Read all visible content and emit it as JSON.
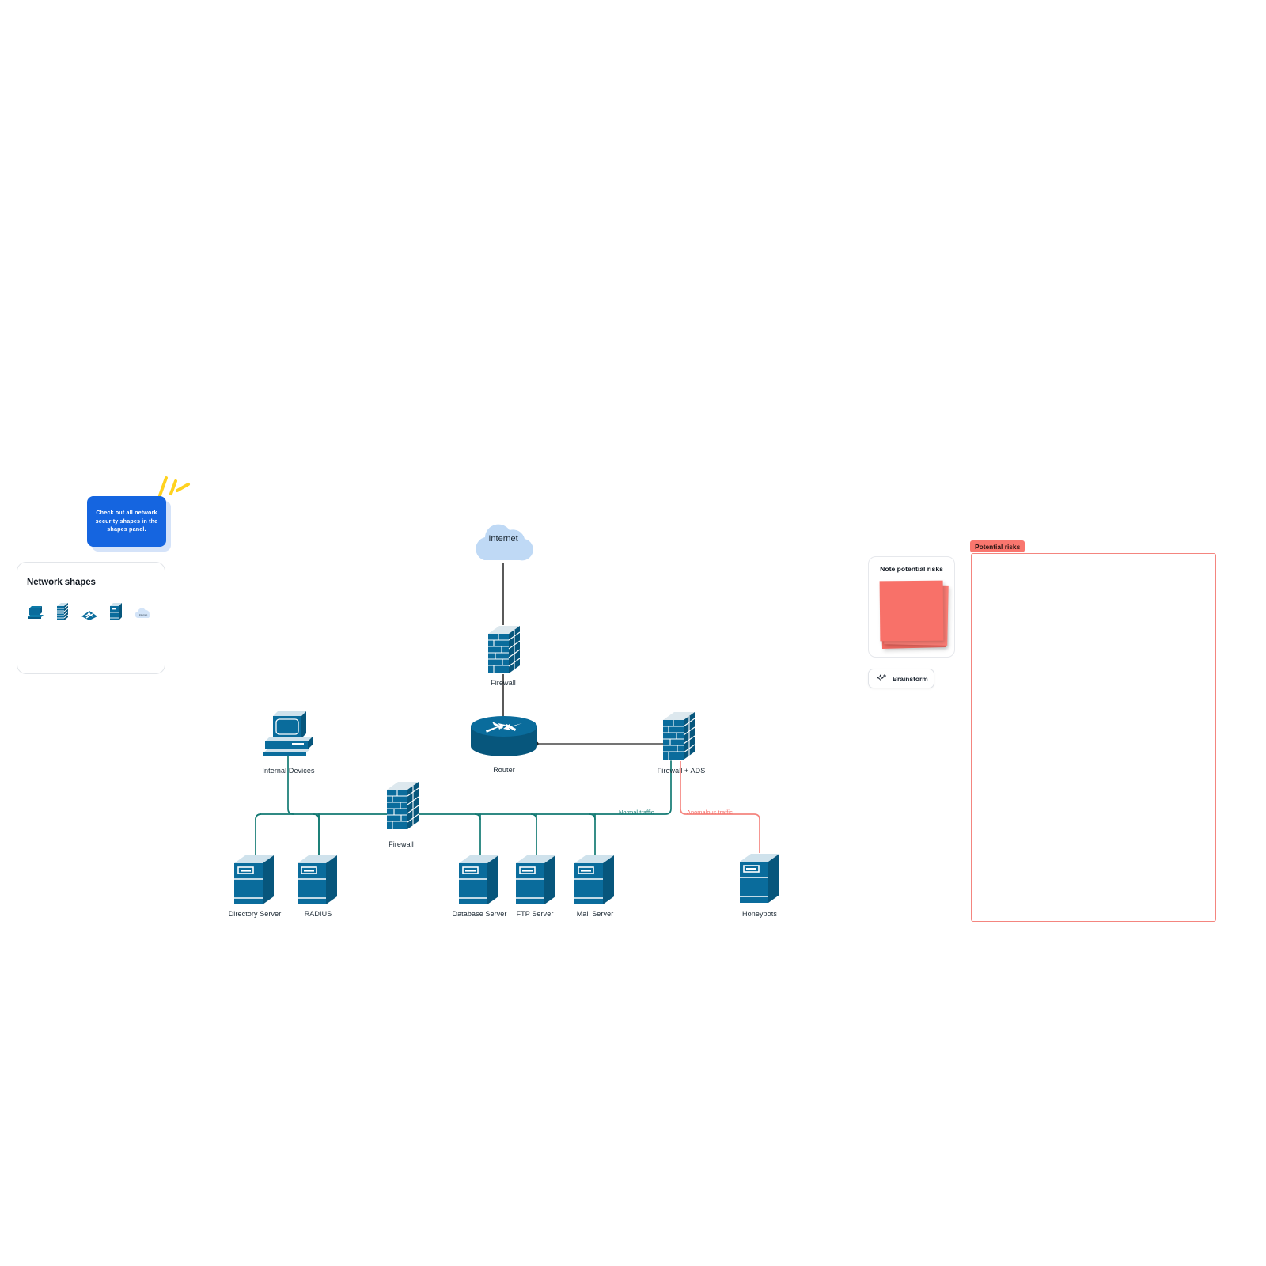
{
  "tooltip": {
    "text": "Check out all network security shapes in the shapes panel."
  },
  "shapes_panel": {
    "title": "Network shapes",
    "items": [
      {
        "name": "computer-shape",
        "label": "Computer"
      },
      {
        "name": "firewall-shape",
        "label": "Firewall"
      },
      {
        "name": "switch-shape",
        "label": "Switch"
      },
      {
        "name": "server-shape",
        "label": "Server"
      },
      {
        "name": "cloud-shape",
        "label": "Internet"
      }
    ]
  },
  "risk_card": {
    "title": "Note potential risks",
    "brainstorm_label": "Brainstorm",
    "sparkle_icon": "sparkle-icon"
  },
  "risk_frame": {
    "label": "Potential risks"
  },
  "diagram": {
    "nodes": [
      {
        "id": "internet",
        "label": "Internet",
        "type": "cloud"
      },
      {
        "id": "firewall-top",
        "label": "Firewall",
        "type": "firewall"
      },
      {
        "id": "router",
        "label": "Router",
        "type": "router"
      },
      {
        "id": "firewall-ads",
        "label": "Firewall + ADS",
        "type": "firewall"
      },
      {
        "id": "internal-devices",
        "label": "Internal Devices",
        "type": "computer"
      },
      {
        "id": "firewall-core",
        "label": "Firewall",
        "type": "firewall"
      },
      {
        "id": "directory-server",
        "label": "Directory Server",
        "type": "server"
      },
      {
        "id": "radius",
        "label": "RADIUS",
        "type": "server"
      },
      {
        "id": "database-server",
        "label": "Database Server",
        "type": "server"
      },
      {
        "id": "ftp-server",
        "label": "FTP Server",
        "type": "server"
      },
      {
        "id": "mail-server",
        "label": "Mail Server",
        "type": "server"
      },
      {
        "id": "honeypots",
        "label": "Honeypots",
        "type": "server"
      }
    ],
    "edge_labels": [
      {
        "id": "normal-traffic",
        "label": "Normal traffic",
        "color": "#137a73"
      },
      {
        "id": "anomalous-traffic",
        "label": "Anomalous traffic",
        "color": "#f4716b"
      }
    ]
  },
  "colors": {
    "node_blue": "#0a6c9c",
    "node_blue_dark": "#095a82",
    "cloud_blue": "#bfd9f5",
    "normal_traffic": "#137a73",
    "anomalous_traffic": "#f4857f",
    "tooltip_blue": "#1565e0",
    "sticky_red": "#f9736b",
    "frame_red": "#f4857f"
  }
}
